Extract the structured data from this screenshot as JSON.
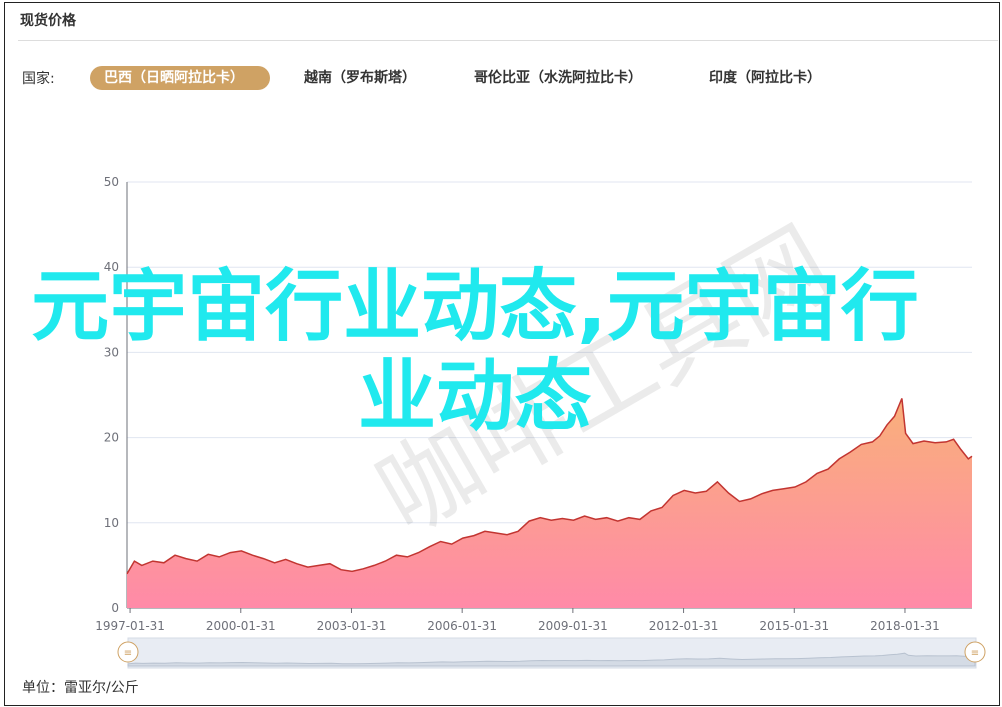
{
  "title": "现货价格",
  "country_label": "国家:",
  "tabs": [
    {
      "label": "巴西（日晒阿拉比卡）",
      "active": true
    },
    {
      "label": "越南（罗布斯塔）",
      "active": false
    },
    {
      "label": "哥伦比亚（水洗阿拉比卡）",
      "active": false
    },
    {
      "label": "印度（阿拉比卡）",
      "active": false
    }
  ],
  "unit_label": "单位：雷亚尔/公斤",
  "overlay_text": "元宇宙行业动态,元宇宙行业动态",
  "watermark_text": "咖啡工具网",
  "colors": {
    "accent": "#cfa264",
    "line": "#c23531",
    "area_top": "#f9b07a",
    "area_bottom": "#ff8aa8",
    "overlay": "#20e9ee"
  },
  "chart_data": {
    "type": "area",
    "y_ticks": [
      "0",
      "10",
      "20",
      "30",
      "40",
      "50"
    ],
    "x_ticks": [
      "1997-01-31",
      "2000-01-31",
      "2003-01-31",
      "2006-01-31",
      "2009-01-31",
      "2012-01-31",
      "2015-01-31",
      "2018-01-31"
    ],
    "ylim": [
      0,
      50
    ],
    "xlim": [
      1997.0,
      2019.9
    ],
    "x": [
      1997.0,
      1997.2,
      1997.4,
      1997.7,
      1998.0,
      1998.3,
      1998.6,
      1998.9,
      1999.2,
      1999.5,
      1999.8,
      2000.1,
      2000.4,
      2000.7,
      2001.0,
      2001.3,
      2001.6,
      2001.9,
      2002.2,
      2002.5,
      2002.8,
      2003.1,
      2003.4,
      2003.7,
      2004.0,
      2004.3,
      2004.6,
      2004.9,
      2005.2,
      2005.5,
      2005.8,
      2006.1,
      2006.4,
      2006.7,
      2007.0,
      2007.3,
      2007.6,
      2007.9,
      2008.2,
      2008.5,
      2008.8,
      2009.1,
      2009.4,
      2009.7,
      2010.0,
      2010.3,
      2010.6,
      2010.9,
      2011.2,
      2011.5,
      2011.8,
      2012.1,
      2012.4,
      2012.7,
      2013.0,
      2013.3,
      2013.6,
      2013.9,
      2014.2,
      2014.5,
      2014.8,
      2015.1,
      2015.4,
      2015.7,
      2016.0,
      2016.3,
      2016.6,
      2016.9,
      2017.2,
      2017.4,
      2017.6,
      2017.8,
      2018.0,
      2018.1,
      2018.3,
      2018.6,
      2018.9,
      2019.2,
      2019.4,
      2019.6,
      2019.8,
      2019.9
    ],
    "values": [
      4,
      5.5,
      5,
      5.5,
      5.3,
      6.2,
      5.8,
      5.5,
      6.3,
      6,
      6.5,
      6.7,
      6.2,
      5.8,
      5.3,
      5.7,
      5.2,
      4.8,
      5.0,
      5.2,
      4.5,
      4.3,
      4.6,
      5.0,
      5.5,
      6.2,
      6.0,
      6.5,
      7.2,
      7.8,
      7.5,
      8.2,
      8.5,
      9.0,
      8.8,
      8.6,
      9.0,
      10.2,
      10.6,
      10.3,
      10.5,
      10.3,
      10.8,
      10.4,
      10.6,
      10.2,
      10.6,
      10.4,
      11.4,
      11.8,
      13.2,
      13.8,
      13.5,
      13.7,
      14.8,
      13.5,
      12.5,
      12.8,
      13.4,
      13.8,
      14.0,
      14.2,
      14.8,
      15.8,
      16.3,
      17.5,
      18.3,
      19.2,
      19.5,
      20.2,
      21.5,
      22.5,
      24.6,
      20.5,
      19.3,
      19.6,
      19.4,
      19.5,
      19.8,
      18.6,
      17.5,
      17.8
    ]
  }
}
